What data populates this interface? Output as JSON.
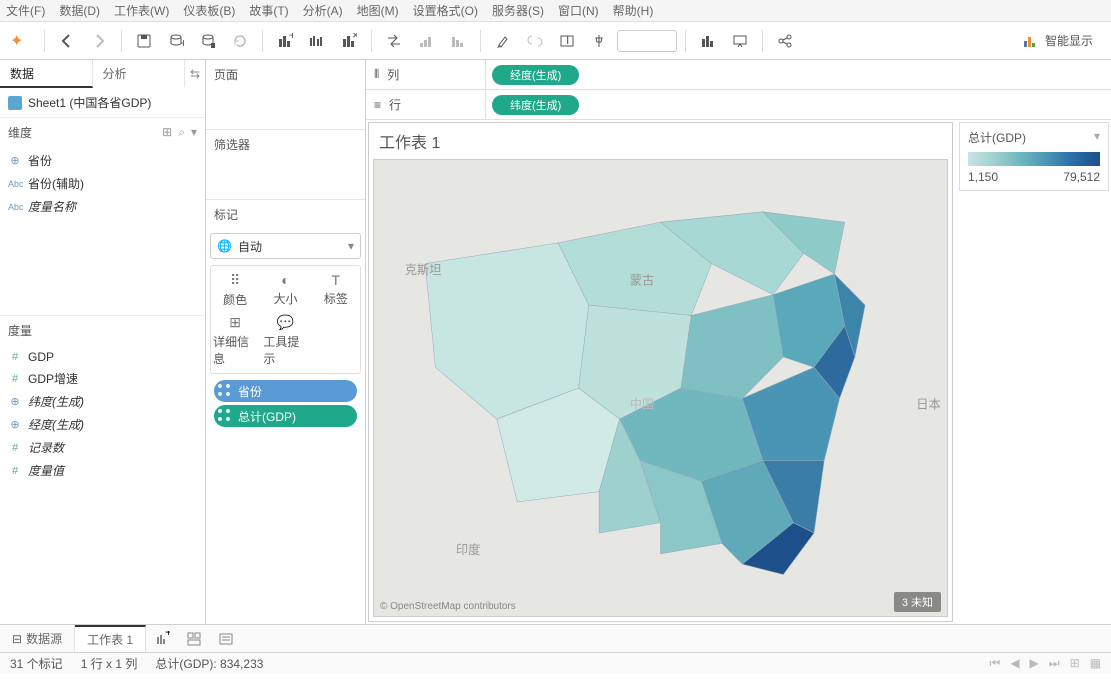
{
  "menu": [
    "文件(F)",
    "数据(D)",
    "工作表(W)",
    "仪表板(B)",
    "故事(T)",
    "分析(A)",
    "地图(M)",
    "设置格式(O)",
    "服务器(S)",
    "窗口(N)",
    "帮助(H)"
  ],
  "smart_display": "智能显示",
  "sidebar": {
    "tabs": {
      "data": "数据",
      "analysis": "分析"
    },
    "datasource": "Sheet1 (中国各省GDP)",
    "dim_header": "维度",
    "meas_header": "度量",
    "dims": [
      {
        "icon": "globe",
        "label": "省份"
      },
      {
        "icon": "abc",
        "label": "省份(辅助)"
      },
      {
        "icon": "abc",
        "label": "度量名称",
        "italic": true
      }
    ],
    "meas": [
      {
        "icon": "hash",
        "label": "GDP"
      },
      {
        "icon": "hash",
        "label": "GDP增速"
      },
      {
        "icon": "globe",
        "label": "纬度(生成)",
        "italic": true
      },
      {
        "icon": "globe",
        "label": "经度(生成)",
        "italic": true
      },
      {
        "icon": "hash",
        "label": "记录数",
        "italic": true
      },
      {
        "icon": "hash",
        "label": "度量值",
        "italic": true
      }
    ]
  },
  "midcol": {
    "pages": "页面",
    "filters": "筛选器",
    "marks": "标记",
    "mark_type": "自动",
    "cells": {
      "color": "颜色",
      "size": "大小",
      "label": "标签",
      "detail": "详细信息",
      "tooltip": "工具提示"
    },
    "pills": [
      {
        "color": "blue",
        "label": "省份"
      },
      {
        "color": "green",
        "label": "总计(GDP)"
      }
    ]
  },
  "shelves": {
    "columns_label": "列",
    "rows_label": "行",
    "columns_pill": "经度(生成)",
    "rows_pill": "纬度(生成)"
  },
  "viz": {
    "title": "工作表 1",
    "attribution": "© OpenStreetMap contributors",
    "unknown": "3 未知",
    "map_labels": {
      "kz": "克斯坦",
      "mn": "蒙古",
      "cn": "中国",
      "in": "印度",
      "jp": "日本"
    }
  },
  "legend": {
    "title": "总计(GDP)",
    "min": "1,150",
    "max": "79,512"
  },
  "bottom": {
    "datasource": "数据源",
    "sheet": "工作表 1"
  },
  "status": {
    "marks": "31 个标记",
    "rc": "1 行 x 1 列",
    "sum": "总计(GDP): 834,233"
  }
}
